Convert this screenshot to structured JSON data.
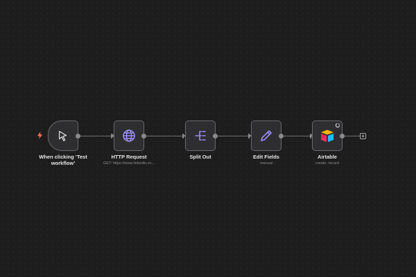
{
  "workflow": {
    "nodes": [
      {
        "id": "trigger",
        "label": "When clicking ‘Test workflow’",
        "subtitle": "",
        "icon": "cursor-icon"
      },
      {
        "id": "http",
        "label": "HTTP Request",
        "subtitle": "GET: https://www.linkedin.co...",
        "icon": "globe-icon"
      },
      {
        "id": "split",
        "label": "Split Out",
        "subtitle": "",
        "icon": "split-out-icon"
      },
      {
        "id": "edit",
        "label": "Edit Fields",
        "subtitle": "manual",
        "icon": "pencil-icon"
      },
      {
        "id": "airtable",
        "label": "Airtable",
        "subtitle": "create: record",
        "icon": "airtable-logo-icon"
      }
    ],
    "add_node_label": "+"
  },
  "colors": {
    "canvas": "#1d1d1d",
    "node_bg": "#2e2e30",
    "node_border": "#6a6a6e",
    "accent_purple": "#9b8cf7",
    "trigger_bolt": "#ff6d5a"
  }
}
